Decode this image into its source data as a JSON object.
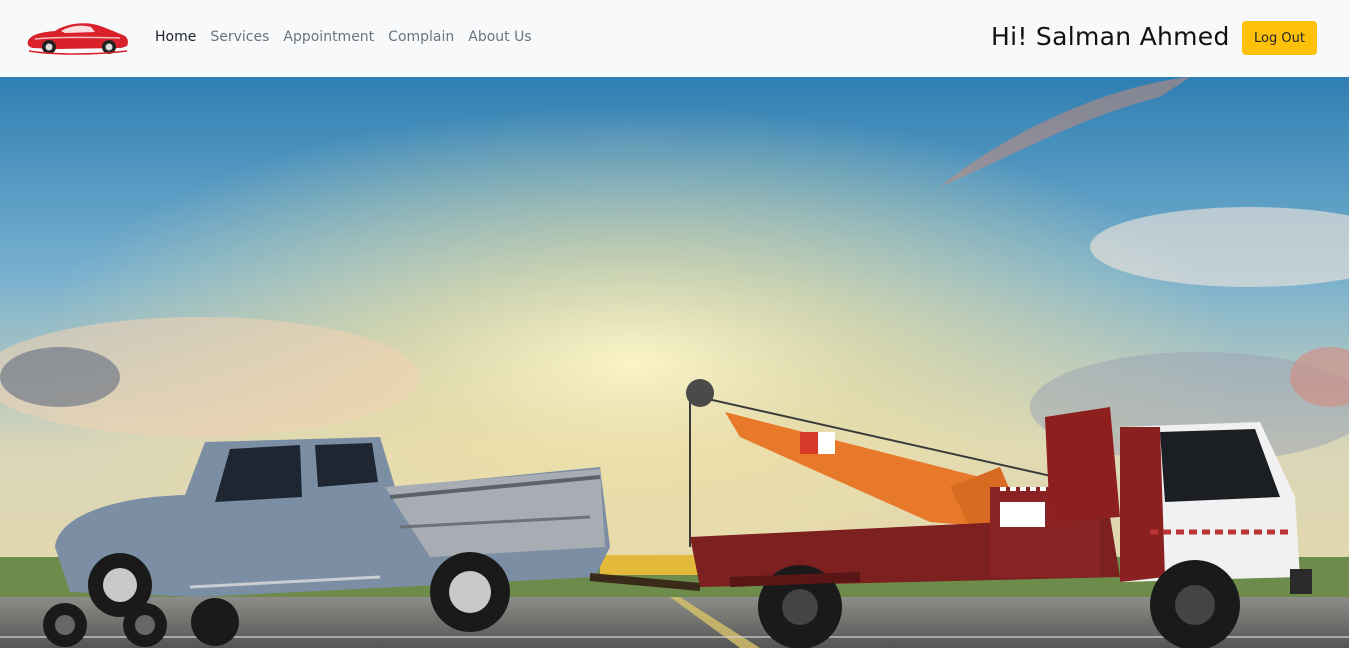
{
  "brand": {
    "logo_icon": "red-car-logo-icon",
    "accent": "#d8212a"
  },
  "nav": {
    "items": [
      {
        "label": "Home",
        "active": true
      },
      {
        "label": "Services",
        "active": false
      },
      {
        "label": "Appointment",
        "active": false
      },
      {
        "label": "Complain",
        "active": false
      },
      {
        "label": "About Us",
        "active": false
      }
    ]
  },
  "user": {
    "greeting": "Hi! Salman Ahmed"
  },
  "actions": {
    "logout_label": "Log Out",
    "logout_color": "#ffc107"
  },
  "hero": {
    "image": "tow-truck-towing-damaged-pickup-on-road-at-sunset"
  }
}
